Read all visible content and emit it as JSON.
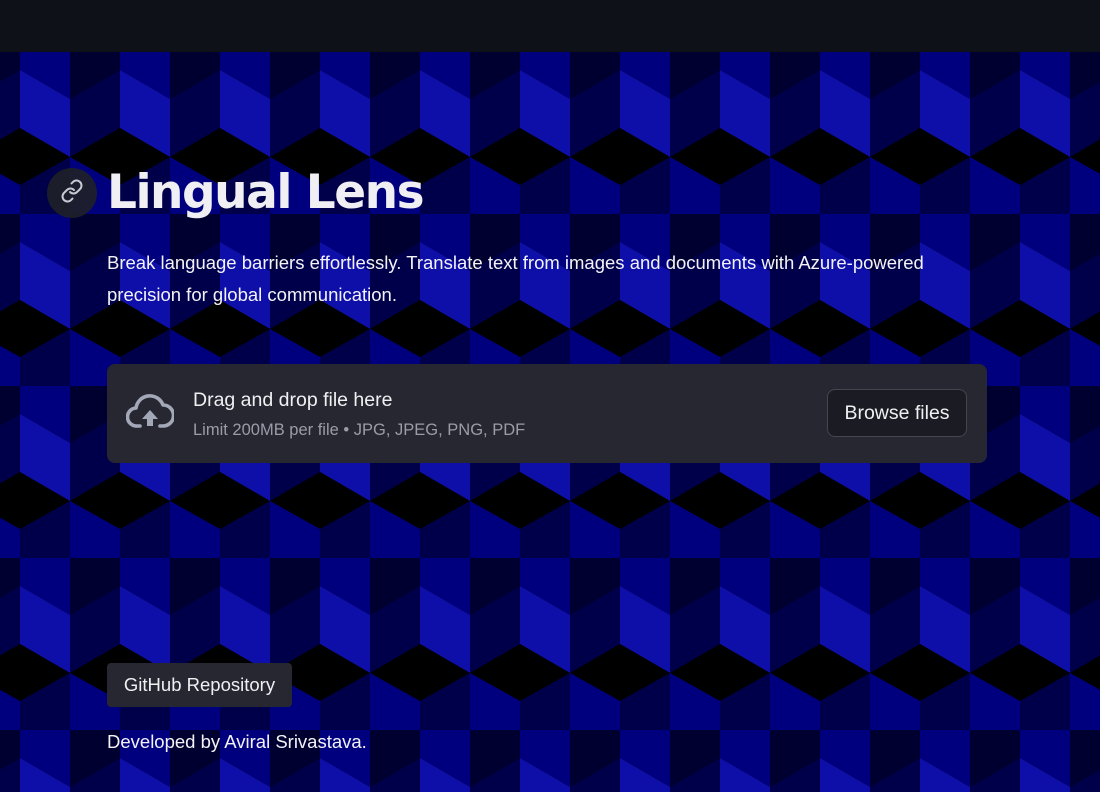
{
  "app": {
    "title": "Lingual Lens",
    "description": "Break language barriers effortlessly. Translate text from images and documents with Azure-powered precision for global communication."
  },
  "header": {
    "anchor_icon": "link-icon"
  },
  "uploader": {
    "icon": "cloud-upload-icon",
    "drop_text": "Drag and drop file here",
    "limit_text": "Limit 200MB per file • JPG, JPEG, PNG, PDF",
    "browse_label": "Browse files"
  },
  "links": {
    "github_label": "GitHub Repository"
  },
  "footer": {
    "credit": "Developed by Aviral Srivastava."
  },
  "colors": {
    "topbar": "#0e1117",
    "pattern_dark": "#000000",
    "pattern_navy": "#00004a",
    "pattern_blue": "#00007e",
    "pattern_bright": "#0e0ea8",
    "widget_bg": "#262730",
    "text": "#f0f0f3",
    "muted_text": "#9a9ca7"
  }
}
